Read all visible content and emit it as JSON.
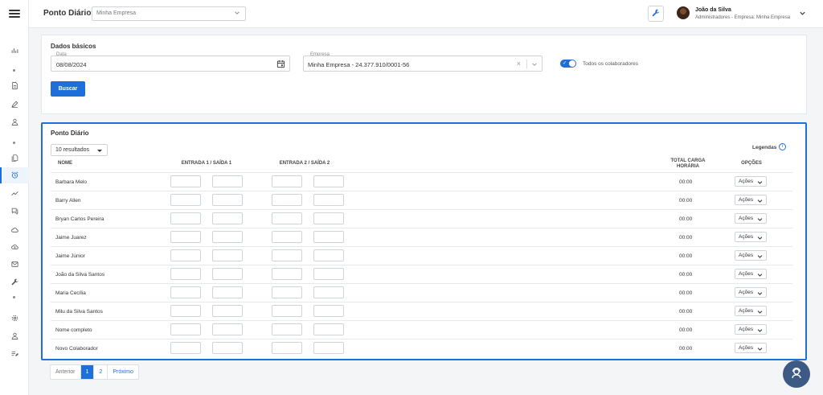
{
  "header": {
    "title": "Ponto Diário",
    "company_select": "Minha Empresa",
    "user_name": "João da Silva",
    "user_role": "Administradores - Empresa: Minha Empresa"
  },
  "sidebar": {
    "icons": [
      "chart-icon",
      "document-icon",
      "pen-icon",
      "user-icon",
      "files-icon",
      "alarm-clock-icon",
      "trend-icon",
      "chat-icon",
      "cloud-icon",
      "cloud-upload-icon",
      "mail-icon",
      "wrench-icon",
      "gear-icon",
      "user-icon",
      "list-edit-icon"
    ]
  },
  "basic": {
    "title": "Dados básicos",
    "date_label": "Data",
    "date_value": "08/08/2024",
    "company_label": "Empresa",
    "company_value": "Minha Empresa - 24.377.910/0001-56",
    "toggle_label": "Todos os colaboradores",
    "toggle_on": true,
    "search_button": "Buscar"
  },
  "table": {
    "title": "Ponto Diário",
    "results_select": "10 resultados",
    "legend": "Legendas",
    "columns": {
      "name": "NOME",
      "shift1": "ENTRADA 1 / SAÍDA 1",
      "shift2": "ENTRADA 2 / SAÍDA 2",
      "total_line1": "TOTAL CARGA",
      "total_line2": "HORÁRIA",
      "options": "OPÇÕES"
    },
    "rows": [
      {
        "name": "Barbara Melo",
        "total": "00:00",
        "action": "Ações"
      },
      {
        "name": "Barry Allen",
        "total": "00:00",
        "action": "Ações"
      },
      {
        "name": "Bryan Carlos Pereira",
        "total": "00:00",
        "action": "Ações"
      },
      {
        "name": "Jaime Juarez",
        "total": "00:00",
        "action": "Ações"
      },
      {
        "name": "Jaime Júnior",
        "total": "00:00",
        "action": "Ações"
      },
      {
        "name": "João da Silva Santos",
        "total": "00:00",
        "action": "Ações"
      },
      {
        "name": "Maria Cecília",
        "total": "00:00",
        "action": "Ações"
      },
      {
        "name": "Milu da Silva Santos",
        "total": "00:00",
        "action": "Ações"
      },
      {
        "name": "Nome completo",
        "total": "00:00",
        "action": "Ações"
      },
      {
        "name": "Novo Colaborador",
        "total": "00:00",
        "action": "Ações"
      }
    ]
  },
  "pagination": {
    "prev": "Anterior",
    "pages": [
      "1",
      "2"
    ],
    "current": "1",
    "next": "Próximo"
  },
  "colors": {
    "accent": "#1e6fd9",
    "fab": "#3d5a84"
  }
}
